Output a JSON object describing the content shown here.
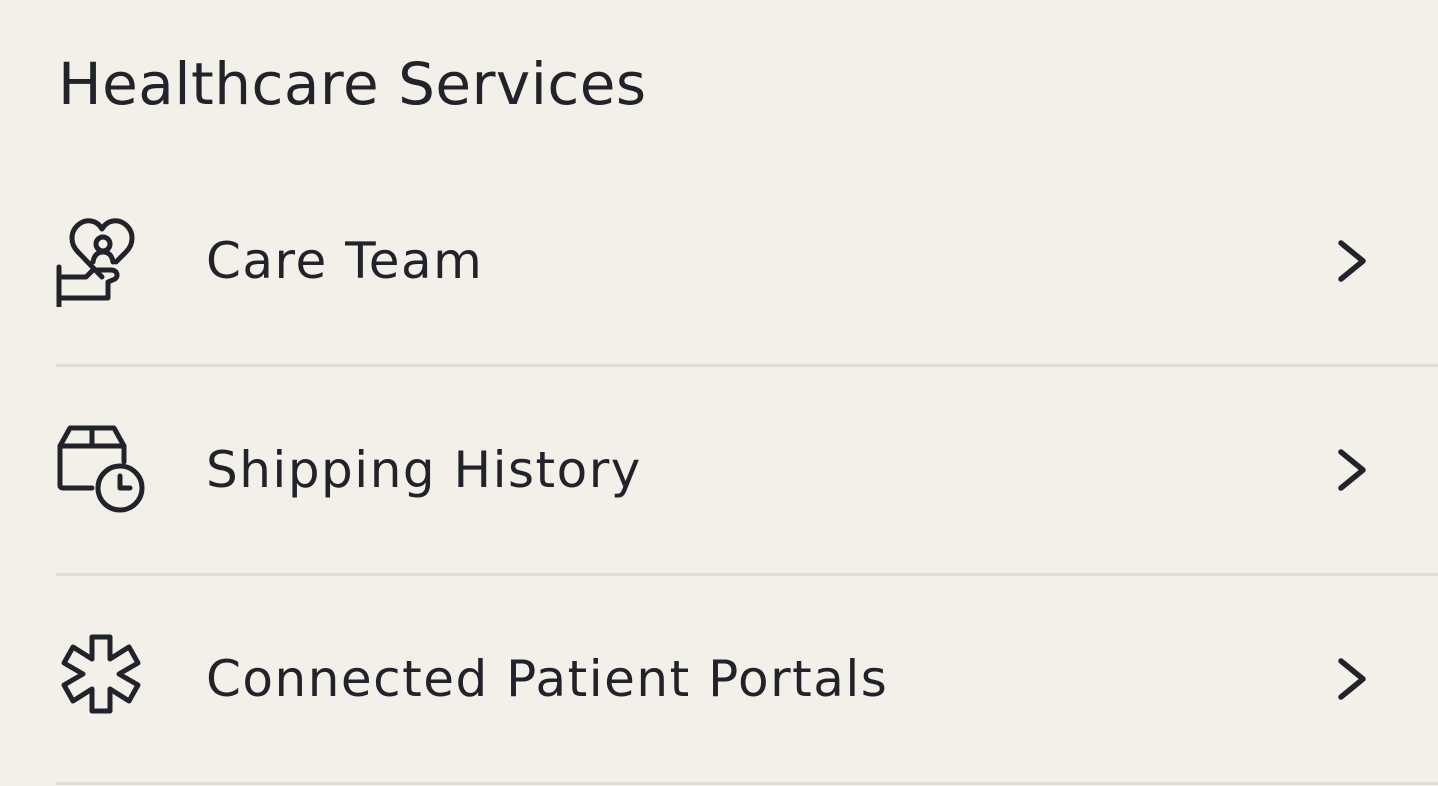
{
  "section": {
    "title": "Healthcare Services"
  },
  "items": [
    {
      "label": "Care Team",
      "icon": "heart-hand-person-icon"
    },
    {
      "label": "Shipping History",
      "icon": "package-clock-icon"
    },
    {
      "label": "Connected Patient Portals",
      "icon": "medical-star-icon"
    }
  ],
  "colors": {
    "background": "#f3f0ea",
    "text": "#22222a",
    "divider": "#e3ddd1"
  }
}
